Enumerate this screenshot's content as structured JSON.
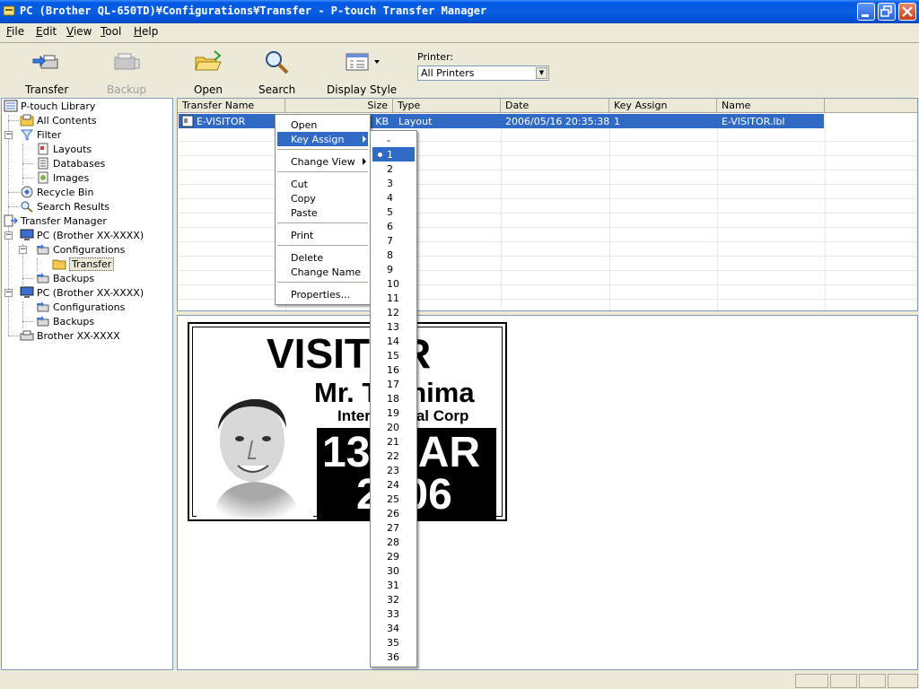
{
  "window": {
    "title": "PC (Brother QL-650TD)¥Configurations¥Transfer - P-touch Transfer Manager"
  },
  "menubar": [
    {
      "label": "File",
      "key": "F"
    },
    {
      "label": "Edit",
      "key": "E"
    },
    {
      "label": "View",
      "key": "V"
    },
    {
      "label": "Tool",
      "key": "T"
    },
    {
      "label": "Help",
      "key": "H"
    }
  ],
  "toolbar": {
    "transfer": "Transfer",
    "backup": "Backup",
    "open": "Open",
    "search": "Search",
    "display_style": "Display Style",
    "printer_label": "Printer:",
    "printer_value": "All Printers"
  },
  "tree": {
    "library": "P-touch Library",
    "all_contents": "All Contents",
    "filter": "Filter",
    "layouts": "Layouts",
    "databases": "Databases",
    "images": "Images",
    "recycle_bin": "Recycle Bin",
    "search_results": "Search Results",
    "transfer_manager": "Transfer Manager",
    "pc1": "PC (Brother XX-XXXX)",
    "configurations1": "Configurations",
    "transfer": "Transfer",
    "backups1": "Backups",
    "pc2": "PC (Brother XX-XXXX)",
    "configurations2": "Configurations",
    "backups2": "Backups",
    "printer": "Brother XX-XXXX"
  },
  "list": {
    "columns": [
      "Transfer Name",
      "Size",
      "Type",
      "Date",
      "Key Assign",
      "Name"
    ],
    "rows": [
      {
        "transfer_name": "E-VISITOR",
        "size": "KB",
        "type": "Layout",
        "date": "2006/05/16 20:35:38",
        "key_assign": "1",
        "name": "E-VISITOR.lbl"
      }
    ]
  },
  "context_menu": {
    "open": "Open",
    "key_assign": "Key Assign",
    "change_view": "Change View",
    "cut": "Cut",
    "copy": "Copy",
    "paste": "Paste",
    "print": "Print",
    "delete": "Delete",
    "change_name": "Change Name",
    "properties": "Properties..."
  },
  "key_assign_submenu": {
    "selected": "1",
    "items": [
      "-",
      "1",
      "2",
      "3",
      "4",
      "5",
      "6",
      "7",
      "8",
      "9",
      "10",
      "11",
      "12",
      "13",
      "14",
      "15",
      "16",
      "17",
      "18",
      "19",
      "20",
      "21",
      "22",
      "23",
      "24",
      "25",
      "26",
      "27",
      "28",
      "29",
      "30",
      "31",
      "32",
      "33",
      "34",
      "35",
      "36"
    ]
  },
  "preview": {
    "line1": "VISITOR",
    "name": "Mr. Toshima",
    "company": "International Corp",
    "date_line1": "13 MAR",
    "date_line2": "2006"
  }
}
